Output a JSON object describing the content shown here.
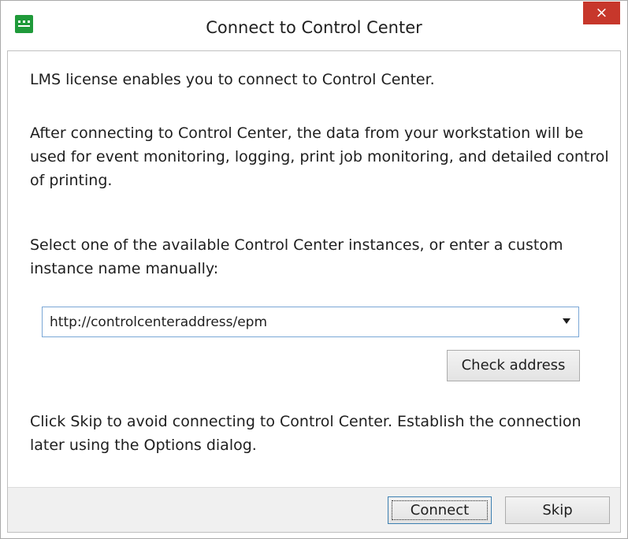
{
  "window": {
    "title": "Connect to Control Center",
    "close_glyph": "×"
  },
  "content": {
    "p1": "LMS license enables you to connect to Control Center.",
    "p2": "After connecting to Control Center, the data from your workstation will be used for event monitoring, logging, print job monitoring, and detailed control of printing.",
    "p3": "Select one of the available Control Center instances, or enter a custom instance name manually:",
    "combo_value": "http://controlcenteraddress/epm",
    "check_label": "Check address",
    "p4": "Click Skip to avoid connecting to Control Center. Establish the connection later using the Options dialog."
  },
  "footer": {
    "connect_label": "Connect",
    "skip_label": "Skip"
  },
  "icons": {
    "app": "app-icon",
    "close": "close-icon",
    "dropdown": "chevron-down-icon"
  },
  "colors": {
    "close_bg": "#c7372b",
    "app_icon": "#1f9a3a",
    "combo_border": "#7aa7d6"
  }
}
